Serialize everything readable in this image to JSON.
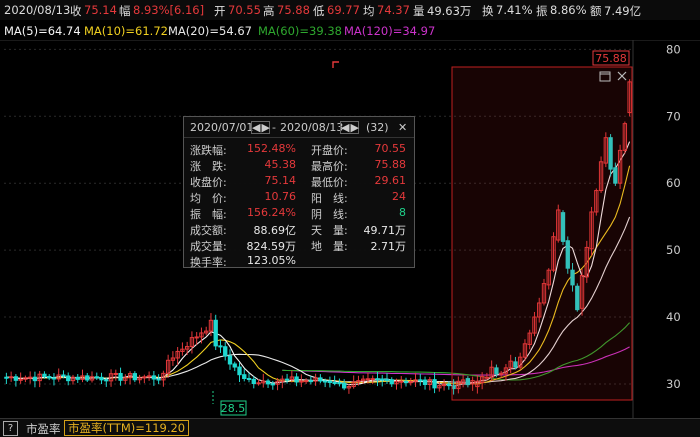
{
  "infobar": {
    "date": "2020/08/13",
    "close_label": "收",
    "close_value": "75.14",
    "change_label": "幅",
    "change_value": "8.93%[6.16]",
    "open_label": "开",
    "open_value": "70.55",
    "high_label": "高",
    "high_value": "75.88",
    "low_label": "低",
    "low_value": "69.77",
    "avg_label": "均",
    "avg_value": "74.37",
    "volume_label": "量",
    "volume_value": "49.63万",
    "turnover_label": "换",
    "turnover_value": "7.41%",
    "amplitude_label": "振",
    "amplitude_value": "8.86%",
    "amount_label": "额",
    "amount_value": "7.49亿"
  },
  "ma_bar": {
    "ma5": "MA(5)=64.74",
    "ma10": "MA(10)=61.72",
    "ma20": "MA(20)=54.67",
    "ma60": "MA(60)=39.38",
    "ma120": "MA(120)=34.97"
  },
  "colors": {
    "up": "#e5393b",
    "down": "#1fd8d0",
    "ma5": "#f5f5f5",
    "ma10": "#f0d020",
    "ma20": "#e8e8e8",
    "ma60": "#2ea82e",
    "ma120": "#cc33cc",
    "pe_ttm": "#e5b020"
  },
  "chart_data": {
    "type": "candlestick",
    "y_ticks": [
      "80",
      "70",
      "60",
      "50",
      "40",
      "30"
    ],
    "ylim": [
      27.6,
      80.8
    ],
    "max_label": "75.88",
    "min_label": "28.5",
    "selection": {
      "from": "2020/07/01",
      "to": "2020/08/13"
    },
    "candles_sample": [
      {
        "o": 30.1,
        "c": 30.6
      },
      {
        "o": 30.8,
        "c": 29.9
      },
      {
        "o": 30.0,
        "c": 30.5
      },
      {
        "o": 29.6,
        "c": 30.4
      },
      {
        "o": 30.2,
        "c": 31.1
      },
      {
        "o": 30.9,
        "c": 31.0
      },
      {
        "o": 31.0,
        "c": 32.5
      },
      {
        "o": 32.4,
        "c": 31.5
      },
      {
        "o": 31.5,
        "c": 31.6
      },
      {
        "o": 31.6,
        "c": 32.4
      },
      {
        "o": 32.4,
        "c": 33.4
      },
      {
        "o": 33.3,
        "c": 32.5
      },
      {
        "o": 32.5,
        "c": 34.0
      },
      {
        "o": 34.0,
        "c": 36.0
      },
      {
        "o": 35.9,
        "c": 37.6
      },
      {
        "o": 37.6,
        "c": 40.0
      },
      {
        "o": 40.0,
        "c": 42.1
      },
      {
        "o": 42.1,
        "c": 45.0
      },
      {
        "o": 44.8,
        "c": 47.0
      },
      {
        "o": 47.0,
        "c": 52.0
      },
      {
        "o": 51.5,
        "c": 56.0
      },
      {
        "o": 55.6,
        "c": 51.3
      },
      {
        "o": 51.4,
        "c": 47.3
      },
      {
        "o": 47.0,
        "c": 44.8
      },
      {
        "o": 44.6,
        "c": 41.1
      },
      {
        "o": 41.3,
        "c": 46.2
      },
      {
        "o": 46.0,
        "c": 50.4
      },
      {
        "o": 50.2,
        "c": 55.7
      },
      {
        "o": 55.7,
        "c": 58.9
      },
      {
        "o": 58.9,
        "c": 63.2
      },
      {
        "o": 63.0,
        "c": 66.8
      },
      {
        "o": 66.8,
        "c": 62.1
      },
      {
        "o": 62.3,
        "c": 60.0
      },
      {
        "o": 60.0,
        "c": 64.9
      },
      {
        "o": 64.9,
        "c": 68.9
      },
      {
        "o": 70.55,
        "c": 75.14
      }
    ]
  },
  "stats_panel": {
    "date_from": "2020/07/01",
    "separator": "-",
    "date_to": "2020/08/13",
    "count": "(32)",
    "rows": [
      {
        "l1": "涨跌幅:",
        "v1": "152.48%",
        "c1": "red",
        "l2": "开盘价:",
        "v2": "70.55",
        "c2": "red"
      },
      {
        "l1": "涨　跌:",
        "v1": "45.38",
        "c1": "red",
        "l2": "最高价:",
        "v2": "75.88",
        "c2": "red"
      },
      {
        "l1": "收盘价:",
        "v1": "75.14",
        "c1": "red",
        "l2": "最低价:",
        "v2": "29.61",
        "c2": "red"
      },
      {
        "l1": "均　价:",
        "v1": "10.76",
        "c1": "red",
        "l2": "阳　线:",
        "v2": "24",
        "c2": "red"
      },
      {
        "l1": "振　幅:",
        "v1": "156.24%",
        "c1": "red",
        "l2": "阴　线:",
        "v2": "8",
        "c2": "grn"
      },
      {
        "l1": "成交额:",
        "v1": "88.69亿",
        "c1": "wht",
        "l2": "天　量:",
        "v2": "49.71万",
        "c2": "wht"
      },
      {
        "l1": "成交量:",
        "v1": "824.59万",
        "c1": "wht",
        "l2": "地　量:",
        "v2": "2.71万",
        "c2": "wht"
      },
      {
        "l1": "换手率:",
        "v1": "123.05%",
        "c1": "wht",
        "l2": "",
        "v2": "",
        "c2": "wht"
      }
    ]
  },
  "bottom_bar": {
    "help": "?",
    "pe_tab": "市盈率",
    "pe_ttm": "市盈率(TTM)=119.20"
  }
}
